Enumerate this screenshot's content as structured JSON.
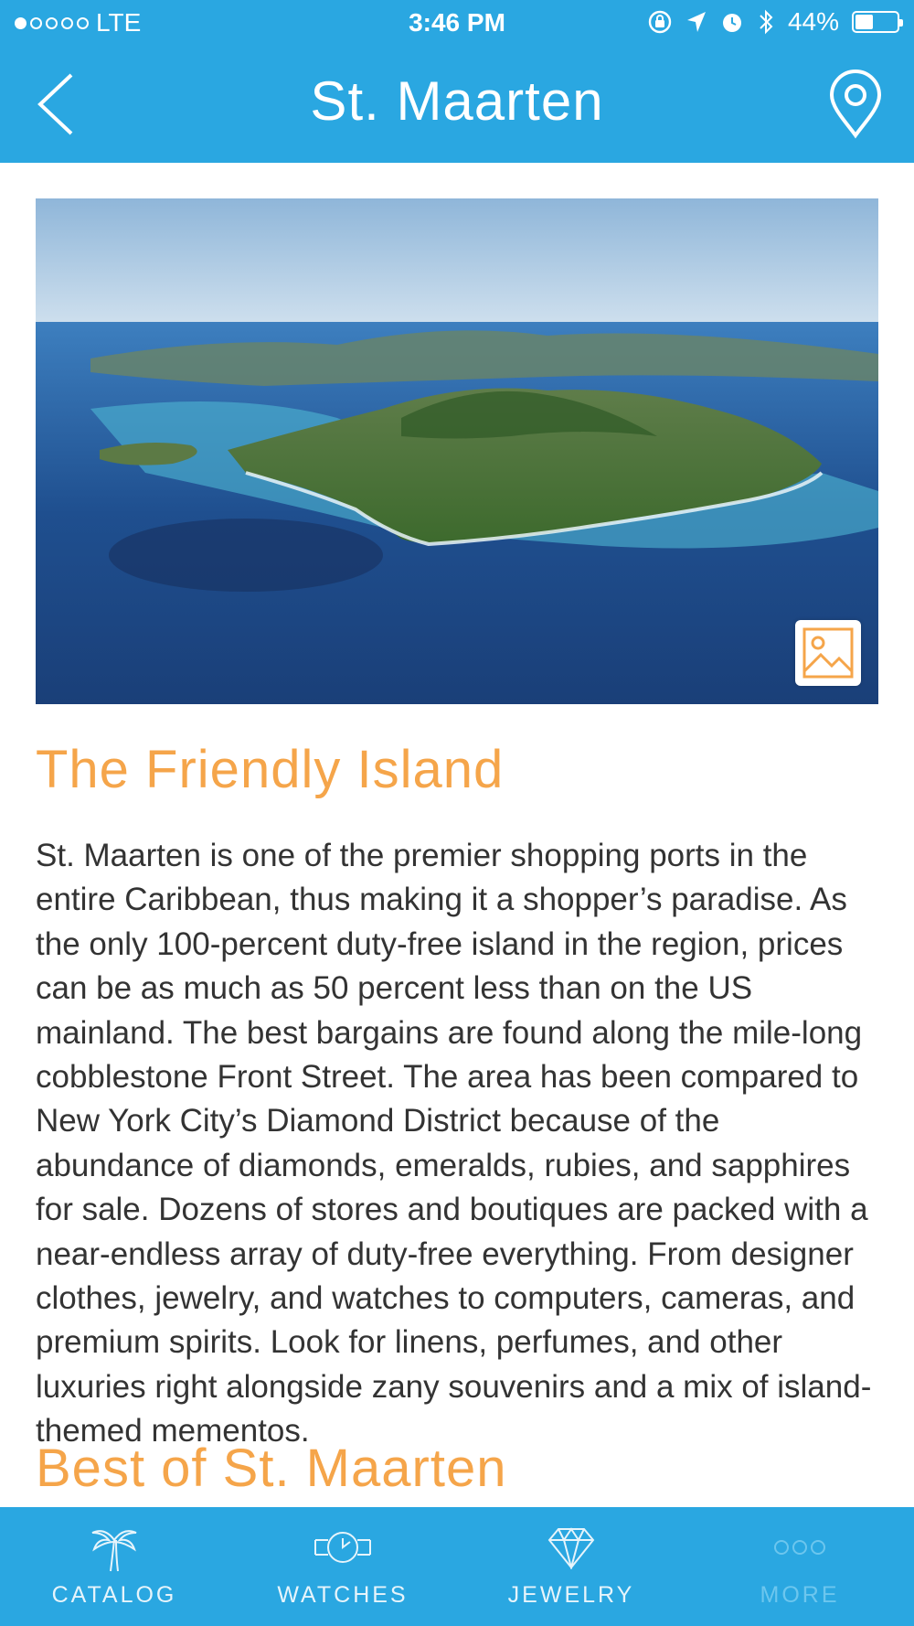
{
  "status_bar": {
    "carrier": "LTE",
    "time": "3:46 PM",
    "battery": "44%",
    "battery_level": 0.44
  },
  "nav": {
    "title": "St. Maarten",
    "back_icon": "chevron-left-icon",
    "location_icon": "map-pin-icon"
  },
  "hero": {
    "gallery_icon": "image-gallery-icon"
  },
  "section1": {
    "heading": "The Friendly Island",
    "body": "St. Maarten is one of the premier shopping ports in the entire Caribbean, thus making it a shopper’s paradise. As the only 100-percent duty-free island in the region, prices can be as much as 50 percent less than on the US mainland. The best bargains are found along the mile-long cobblestone Front Street. The area has been compared to New York City’s Diamond District because of the abundance of diamonds, emeralds, rubies, and sapphires for sale. Dozens of stores and boutiques are packed with a near-endless array of duty-free everything. From designer clothes, jewelry, and watches to computers, cameras, and premium spirits. Look for linens, perfumes, and other luxuries right alongside zany souvenirs and a mix of island-themed mementos."
  },
  "section2": {
    "heading": "Best of St. Maarten"
  },
  "tabs": [
    {
      "label": "CATALOG",
      "icon": "palm-tree-icon"
    },
    {
      "label": "WATCHES",
      "icon": "watch-icon"
    },
    {
      "label": "JEWELRY",
      "icon": "diamond-icon"
    },
    {
      "label": "MORE",
      "icon": "more-dots-icon"
    }
  ],
  "colors": {
    "brand_blue": "#2aa7e1",
    "accent_orange": "#f5a54a"
  }
}
